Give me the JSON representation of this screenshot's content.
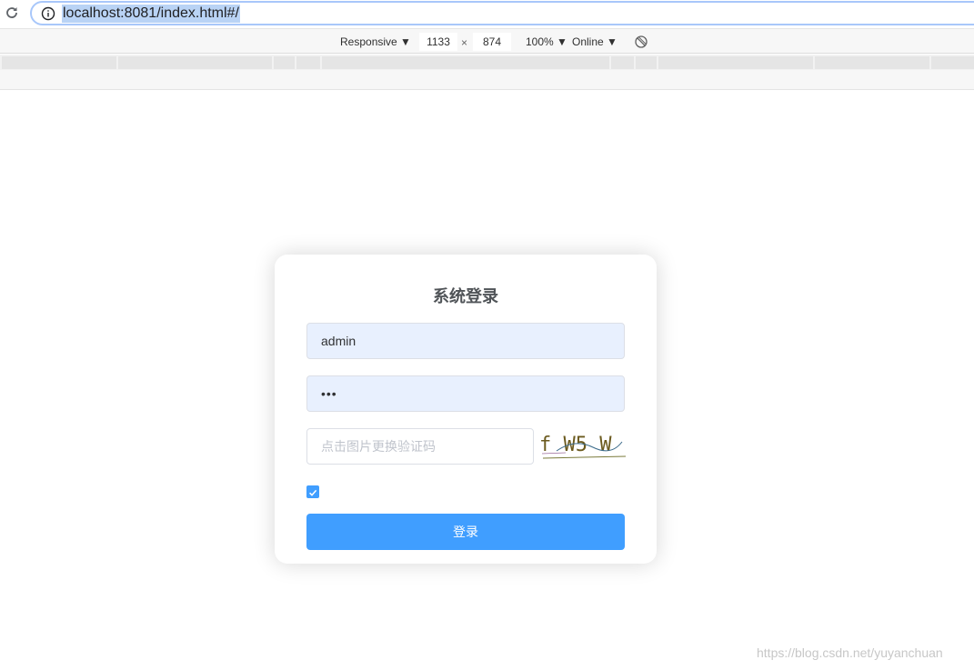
{
  "browser": {
    "url": "localhost:8081/index.html#/"
  },
  "devtools": {
    "device_mode": "Responsive ▼",
    "width": "1133",
    "times": "×",
    "height": "874",
    "zoom": "100% ▼",
    "network": "Online ▼"
  },
  "login": {
    "title": "系统登录",
    "username_value": "admin",
    "password_value": "•••",
    "captcha_placeholder": "点击图片更换验证码",
    "captcha_text": "f W5 W",
    "remember_checked": true,
    "submit_label": "登录"
  },
  "watermark": "https://blog.csdn.net/yuyanchuan",
  "colors": {
    "primary": "#409eff",
    "autofill_bg": "#e8f0fe",
    "title": "#505458"
  }
}
